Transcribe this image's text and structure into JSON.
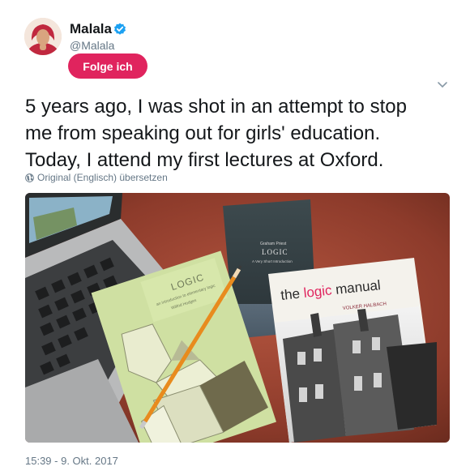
{
  "user": {
    "name": "Malala",
    "handle": "@Malala",
    "verified": true
  },
  "follow_button": {
    "label": "Folge ich"
  },
  "tweet": {
    "text_lines": [
      "5 years ago, I was shot in an attempt to stop",
      "me from speaking out for girls' education.",
      "Today, I attend my first lectures at Oxford."
    ],
    "translate_label": "Original (Englisch) übersetzen",
    "timestamp": "15:39 - 9. Okt. 2017"
  },
  "photo": {
    "books": {
      "logic_left": {
        "title": "LOGIC",
        "subtitle": "an introduction to elementary logic",
        "author": "Wilfrid Hodges"
      },
      "logic_vsi": {
        "author": "Graham Priest",
        "title": "LOGIC",
        "subtitle": "A Very Short Introduction"
      },
      "logic_manual": {
        "title_prefix": "the",
        "title_highlight": "logic",
        "title_suffix": "manual",
        "author": "VOLKER HALBACH"
      }
    }
  },
  "colors": {
    "follow_bg": "#e0245e",
    "verified_blue": "#1da1f2",
    "meta_text": "#657786"
  },
  "icons": [
    "verified-badge-icon",
    "chevron-down-icon",
    "globe-icon"
  ]
}
